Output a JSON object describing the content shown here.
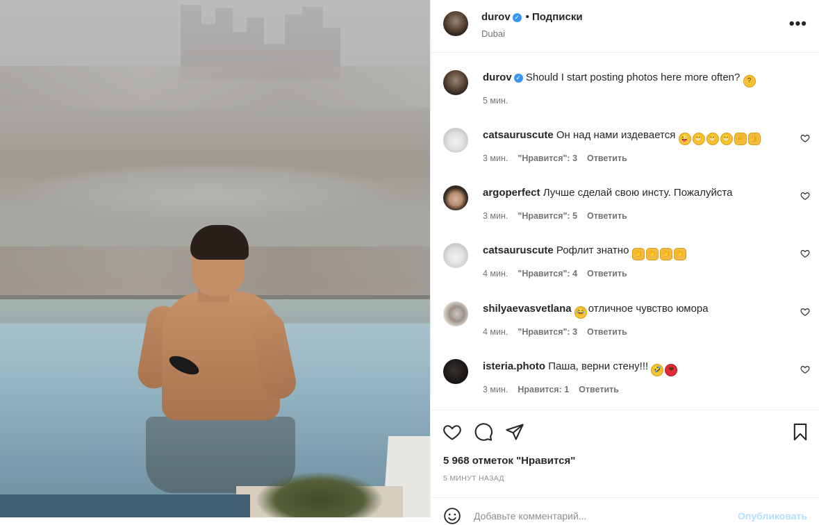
{
  "post": {
    "author": "durov",
    "follow_label": "Подписки",
    "location": "Dubai",
    "caption": "Should I start posting photos here more often?",
    "caption_emoji": "🤔",
    "caption_time": "5 мин."
  },
  "comments": [
    {
      "user": "catsauruscute",
      "text": "Он над нами издевается",
      "emojis": [
        "😜",
        "😁",
        "😁",
        "😁",
        "✌",
        "👍"
      ],
      "time": "3 мин.",
      "likes": "\"Нравится\": 3",
      "reply": "Ответить"
    },
    {
      "user": "argoperfect",
      "text": "Лучше сделай свою инсту. Пожалуйста",
      "emojis": [],
      "time": "3 мин.",
      "likes": "\"Нравится\": 5",
      "reply": "Ответить"
    },
    {
      "user": "catsauruscute",
      "text": "Рофлит знатно",
      "emojis": [
        "👏",
        "👏",
        "👏",
        "👏"
      ],
      "time": "4 мин.",
      "likes": "\"Нравится\": 4",
      "reply": "Ответить"
    },
    {
      "user": "shilyaevasvetlana",
      "text": "отличное чувство юмора",
      "emojis": [
        "😂"
      ],
      "time": "4 мин.",
      "likes": "\"Нравится\": 3",
      "reply": "Ответить"
    },
    {
      "user": "isteria.photo",
      "text": "Паша, верни стену!!!",
      "emojis": [
        "🤣",
        "❤"
      ],
      "time": "3 мин.",
      "likes": "Нравится: 1",
      "reply": "Ответить"
    }
  ],
  "actions": {
    "icons": [
      "heart-icon",
      "comment-icon",
      "share-icon",
      "bookmark-icon"
    ],
    "likes_text": "5 968 отметок \"Нравится\"",
    "posted_text": "5 МИНУТ НАЗАД"
  },
  "comment_box": {
    "placeholder": "Добавьте комментарий...",
    "publish_label": "Опубликовать"
  },
  "colors": {
    "accent": "#3897f0",
    "publish_disabled": "#b2dffc",
    "muted": "#737373"
  }
}
